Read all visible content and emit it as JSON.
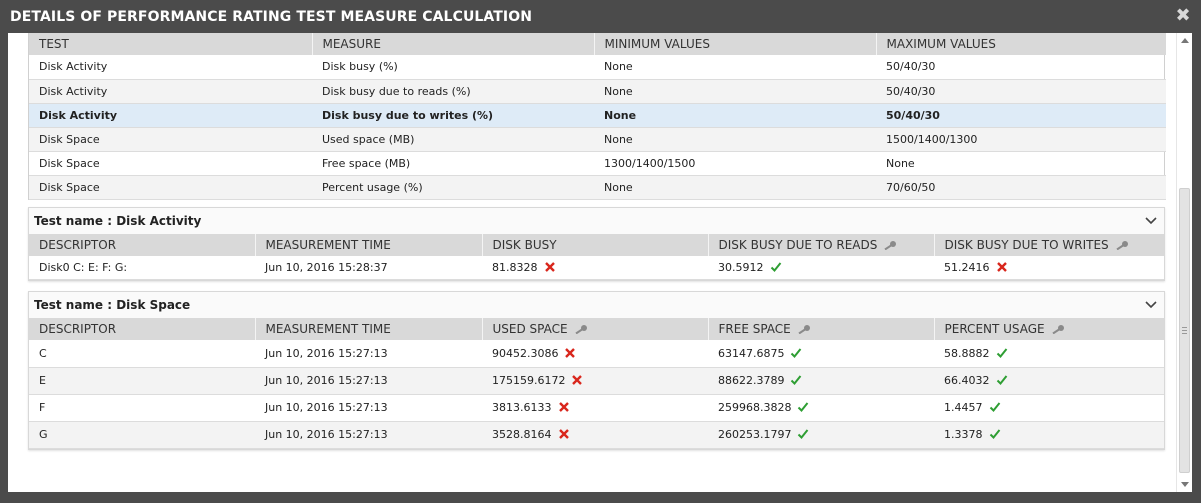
{
  "window": {
    "title": "DETAILS OF PERFORMANCE RATING TEST MEASURE CALCULATION",
    "close_glyph": "✖"
  },
  "rating_table": {
    "headers": [
      "TEST",
      "MEASURE",
      "MINIMUM VALUES",
      "MAXIMUM VALUES"
    ],
    "rows": [
      [
        "Disk Activity",
        "Disk busy (%)",
        "None",
        "50/40/30"
      ],
      [
        "Disk Activity",
        "Disk busy due to reads (%)",
        "None",
        "50/40/30"
      ],
      [
        "Disk Activity",
        "Disk busy due to writes (%)",
        "None",
        "50/40/30"
      ],
      [
        "Disk Space",
        "Used space (MB)",
        "None",
        "1500/1400/1300"
      ],
      [
        "Disk Space",
        "Free space (MB)",
        "1300/1400/1500",
        "None"
      ],
      [
        "Disk Space",
        "Percent usage (%)",
        "None",
        "70/60/50"
      ]
    ]
  },
  "panels": [
    {
      "title": "Test name : Disk Activity",
      "headers": [
        "DESCRIPTOR",
        "MEASUREMENT TIME",
        "DISK BUSY",
        "DISK BUSY DUE TO READS",
        "DISK BUSY DUE TO WRITES"
      ],
      "rows": [
        [
          "Disk0 C: E: F: G:",
          "Jun 10, 2016 15:28:37",
          "81.8328",
          "30.5912",
          "51.2416"
        ]
      ]
    },
    {
      "title": "Test name : Disk Space",
      "headers": [
        "DESCRIPTOR",
        "MEASUREMENT TIME",
        "USED SPACE",
        "FREE SPACE",
        "PERCENT USAGE"
      ],
      "rows": [
        [
          "C",
          "Jun 10, 2016 15:27:13",
          "90452.3086",
          "63147.6875",
          "58.8882"
        ],
        [
          "E",
          "Jun 10, 2016 15:27:13",
          "175159.6172",
          "88622.3789",
          "66.4032"
        ],
        [
          "F",
          "Jun 10, 2016 15:27:13",
          "3813.6133",
          "259968.3828",
          "1.4457"
        ],
        [
          "G",
          "Jun 10, 2016 15:27:13",
          "3528.8164",
          "260253.1797",
          "1.3378"
        ]
      ]
    }
  ],
  "colors": {
    "fail": "#d9261c",
    "pass": "#2e9e33",
    "highlight": "#deebf7",
    "header": "#d9d9d9",
    "titlebar": "#4b4b4b"
  }
}
